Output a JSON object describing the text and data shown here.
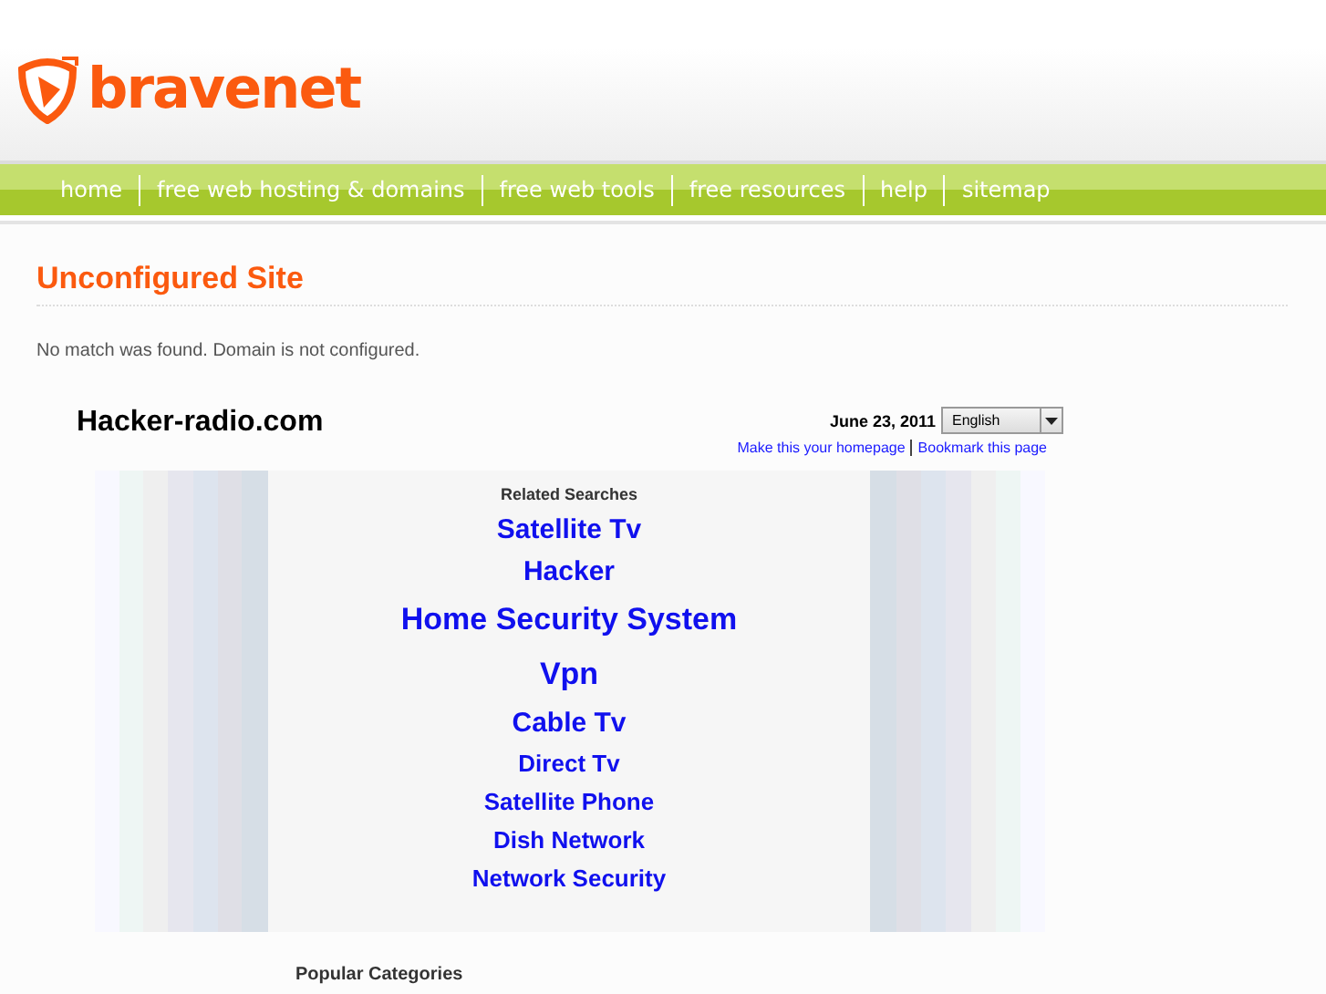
{
  "logo": {
    "text": "bravenet"
  },
  "nav": [
    {
      "label": "home"
    },
    {
      "label": "free web hosting & domains"
    },
    {
      "label": "free web tools"
    },
    {
      "label": "free resources"
    },
    {
      "label": "help"
    },
    {
      "label": "sitemap"
    }
  ],
  "page": {
    "title": "Unconfigured Site",
    "message": "No match was found. Domain is not configured."
  },
  "parked": {
    "domain": "Hacker-radio.com",
    "date": "June 23, 2011",
    "language": "English",
    "links": [
      {
        "label": "Make this your homepage"
      },
      {
        "label": "Bookmark this page"
      }
    ],
    "related_title": "Related Searches",
    "searches": [
      {
        "label": "Satellite Tv",
        "kind": "medium"
      },
      {
        "label": "Hacker",
        "kind": "medium"
      },
      {
        "label": "Home Security System",
        "kind": "large"
      },
      {
        "label": "Vpn",
        "kind": "large"
      },
      {
        "label": "Cable Tv",
        "kind": "medium"
      },
      {
        "label": "Direct Tv",
        "kind": "small"
      },
      {
        "label": "Satellite Phone",
        "kind": "small"
      },
      {
        "label": "Dish Network",
        "kind": "small"
      },
      {
        "label": "Network Security",
        "kind": "small"
      }
    ],
    "categories_title": "Popular Categories"
  }
}
